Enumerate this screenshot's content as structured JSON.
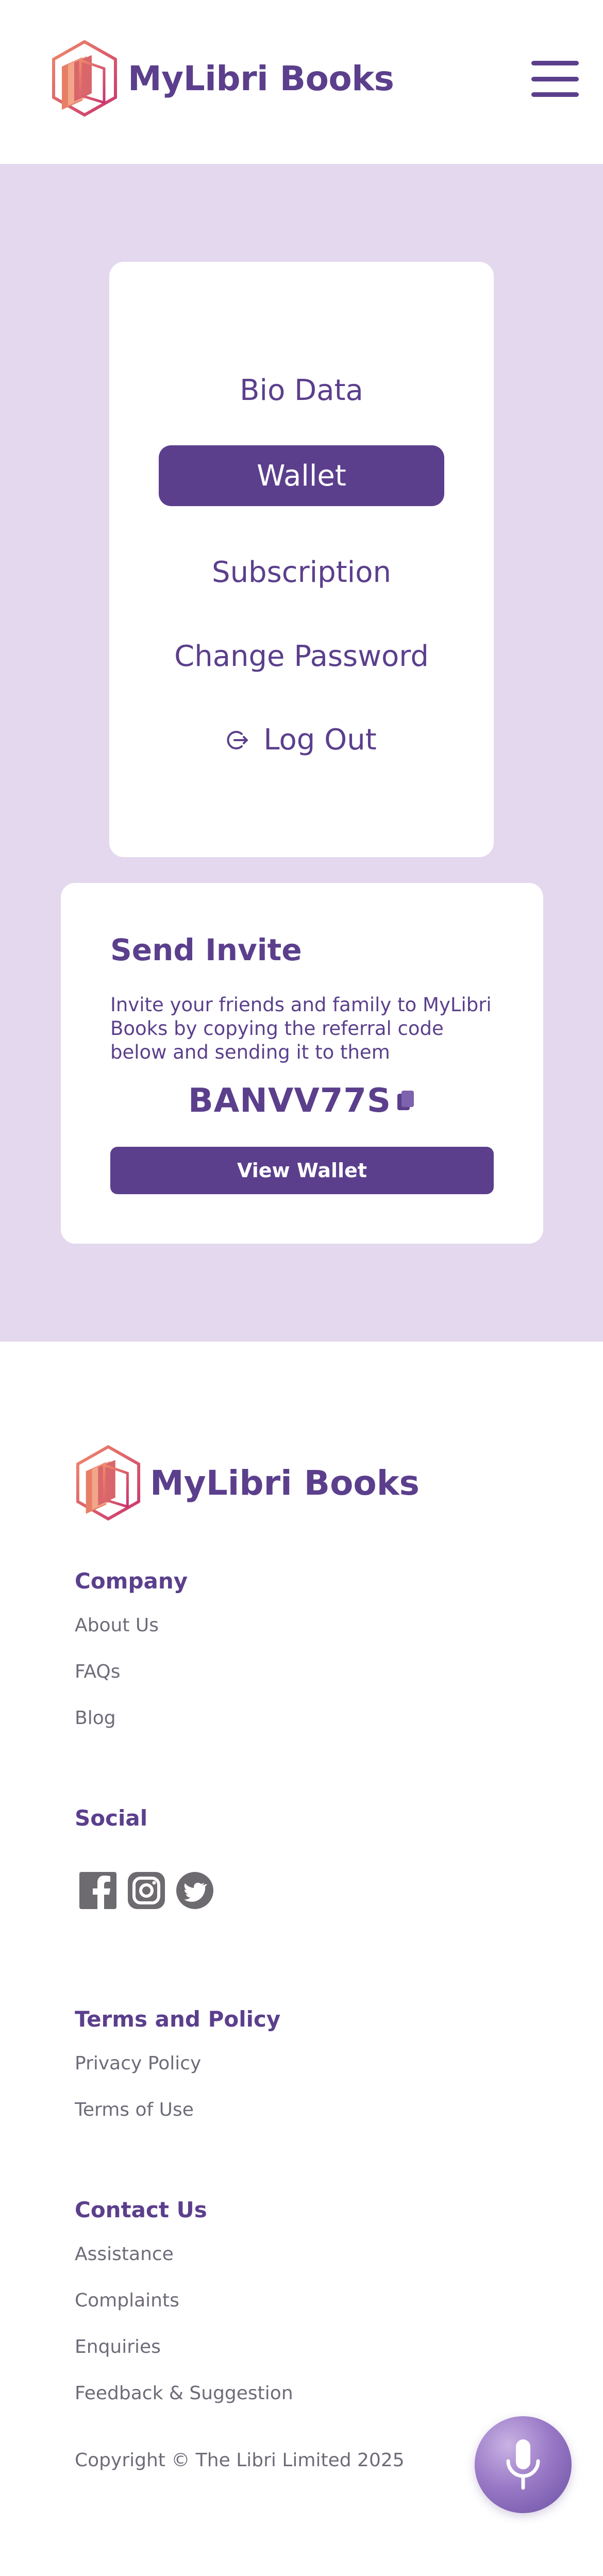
{
  "brand": {
    "name": "MyLibri Books"
  },
  "header": {
    "menu_icon": "hamburger-menu-icon"
  },
  "account_menu": {
    "items": [
      {
        "label": "Bio Data"
      },
      {
        "label": "Wallet",
        "active": true
      },
      {
        "label": "Subscription"
      },
      {
        "label": "Change Password"
      },
      {
        "label": "Log Out",
        "icon": "logout-icon"
      }
    ]
  },
  "invite": {
    "title": "Send Invite",
    "description": "Invite your friends and family to MyLibri Books by copying the referral code below and sending it to them",
    "code": "BANVV77S",
    "copy_icon": "copy-icon",
    "button_label": "View Wallet"
  },
  "footer": {
    "company": {
      "heading": "Company",
      "links": [
        "About Us",
        "FAQs",
        "Blog"
      ]
    },
    "social": {
      "heading": "Social",
      "icons": [
        "facebook-icon",
        "instagram-icon",
        "twitter-icon"
      ]
    },
    "terms": {
      "heading": "Terms and Policy",
      "links": [
        "Privacy Policy",
        "Terms of Use"
      ]
    },
    "contact": {
      "heading": "Contact Us",
      "links": [
        "Assistance",
        "Complaints",
        "Enquiries",
        "Feedback & Suggestion"
      ]
    },
    "copyright": "Copyright © The Libri Limited 2025"
  },
  "voice": {
    "icon": "microphone-icon"
  },
  "colors": {
    "primary": "#5b3f8c",
    "lilac_bg": "#e3d8ee",
    "muted_text": "#6f6b78"
  }
}
